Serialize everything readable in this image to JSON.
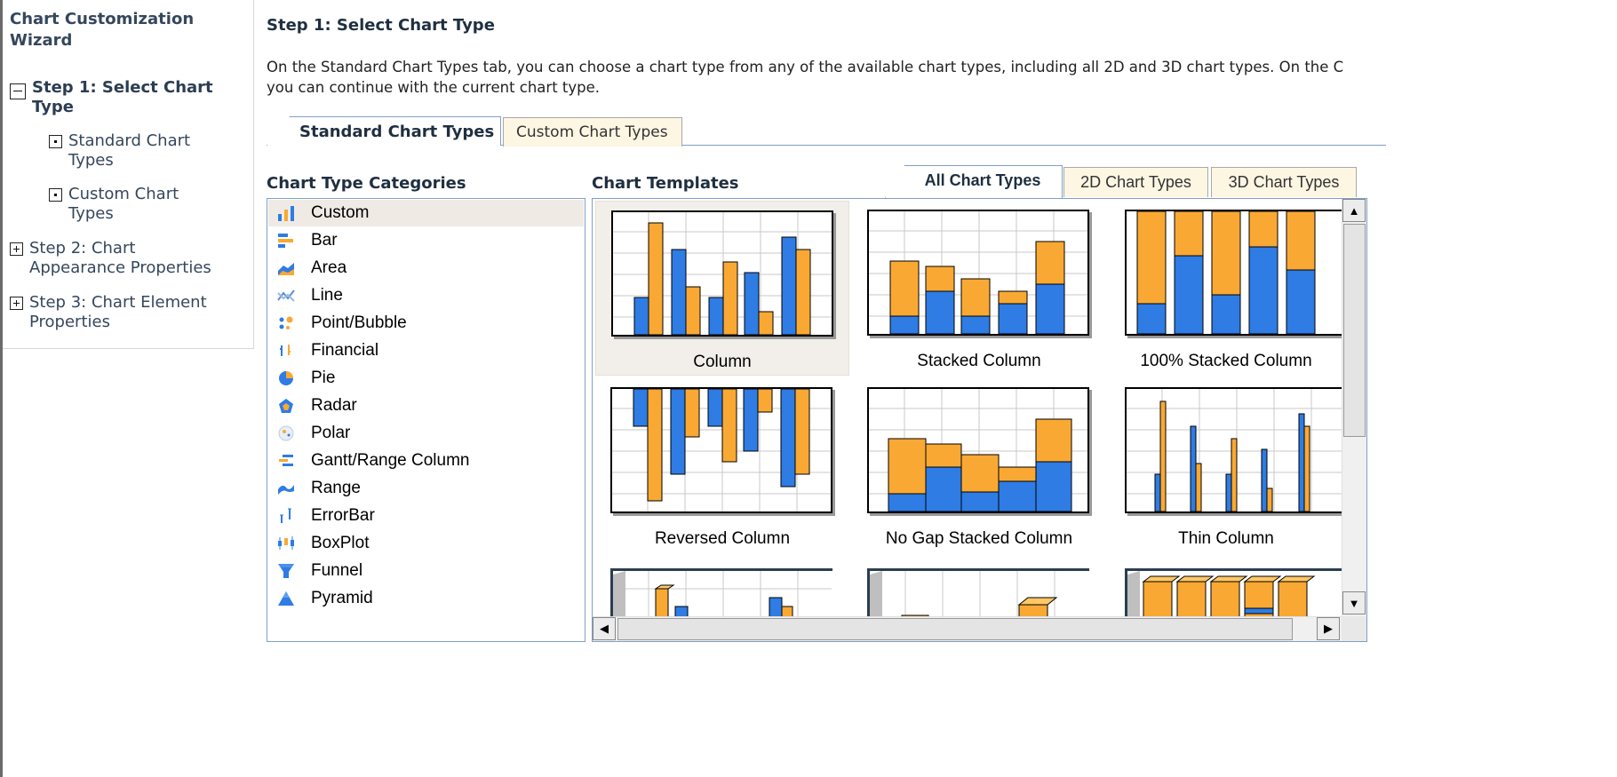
{
  "wizard": {
    "title_line1": "Chart Customization",
    "title_line2": "Wizard",
    "step1": {
      "line1": "Step 1: Select Chart",
      "line2": "Type"
    },
    "standard": {
      "line1": "Standard Chart",
      "line2": "Types"
    },
    "custom": {
      "line1": "Custom Chart",
      "line2": "Types"
    },
    "step2": {
      "line1": "Step 2: Chart",
      "line2": "Appearance Properties"
    },
    "step3": {
      "line1": "Step 3: Chart Element",
      "line2": "Properties"
    }
  },
  "main": {
    "title": "Step 1: Select Chart Type",
    "desc_line1": "On the Standard Chart Types tab, you can choose a chart type from any of the available chart types, including all 2D and 3D chart types. On the C",
    "desc_line2": "you can continue with the current chart type.",
    "tabs": [
      "Standard Chart Types",
      "Custom Chart Types"
    ],
    "categories_label": "Chart Type Categories",
    "templates_label": "Chart Templates",
    "template_tabs": [
      "All Chart Types",
      "2D Chart Types",
      "3D Chart Types"
    ]
  },
  "categories": [
    {
      "label": "Custom",
      "icon": "column-chart-icon"
    },
    {
      "label": "Bar",
      "icon": "bar-chart-icon"
    },
    {
      "label": "Area",
      "icon": "area-chart-icon"
    },
    {
      "label": "Line",
      "icon": "line-chart-icon"
    },
    {
      "label": "Point/Bubble",
      "icon": "point-bubble-icon"
    },
    {
      "label": "Financial",
      "icon": "financial-chart-icon"
    },
    {
      "label": "Pie",
      "icon": "pie-chart-icon"
    },
    {
      "label": "Radar",
      "icon": "radar-chart-icon"
    },
    {
      "label": "Polar",
      "icon": "polar-chart-icon"
    },
    {
      "label": "Gantt/Range Column",
      "icon": "gantt-chart-icon"
    },
    {
      "label": "Range",
      "icon": "range-chart-icon"
    },
    {
      "label": "ErrorBar",
      "icon": "errorbar-chart-icon"
    },
    {
      "label": "BoxPlot",
      "icon": "boxplot-chart-icon"
    },
    {
      "label": "Funnel",
      "icon": "funnel-chart-icon"
    },
    {
      "label": "Pyramid",
      "icon": "pyramid-chart-icon"
    }
  ],
  "templates": [
    {
      "label": "Column"
    },
    {
      "label": "Stacked Column"
    },
    {
      "label": "100% Stacked Column"
    },
    {
      "label": "Reversed Column"
    },
    {
      "label": "No Gap Stacked Column"
    },
    {
      "label": "Thin Column"
    }
  ],
  "colors": {
    "orange": "#f9a933",
    "blue": "#2e7ce4",
    "heading": "#1f2f40",
    "nav": "#35475c",
    "border": "#7fa0c8"
  }
}
